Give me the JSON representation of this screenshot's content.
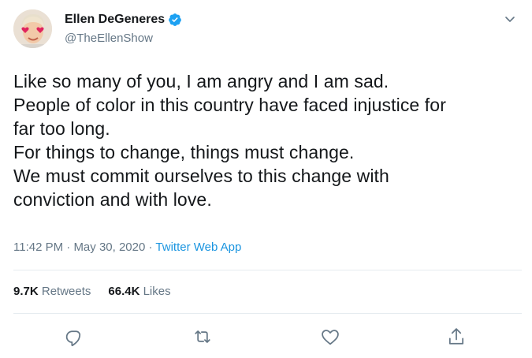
{
  "author": {
    "display_name": "Ellen DeGeneres",
    "handle": "@TheEllenShow",
    "verified_icon": "verified-badge-icon",
    "avatar_icon": "avatar-heart-eyes"
  },
  "tweet": {
    "lines": [
      "Like so many of you, I am angry and I am sad.",
      "People of color in this country have faced injustice for",
      "far too long.",
      "For things to change, things must change.",
      "We must commit ourselves to this change with",
      "conviction and with love."
    ],
    "time": "11:42 PM",
    "separator": "·",
    "date": "May 30, 2020",
    "source": "Twitter Web App"
  },
  "stats": {
    "retweets_count": "9.7K",
    "retweets_label": "Retweets",
    "likes_count": "66.4K",
    "likes_label": "Likes"
  },
  "actions": {
    "reply_icon": "reply-icon",
    "retweet_icon": "retweet-icon",
    "like_icon": "heart-icon",
    "share_icon": "share-icon"
  },
  "colors": {
    "text": "#14171a",
    "secondary": "#657786",
    "link": "#1b95e0",
    "verified": "#1da1f2",
    "divider": "#e6ecf0"
  }
}
